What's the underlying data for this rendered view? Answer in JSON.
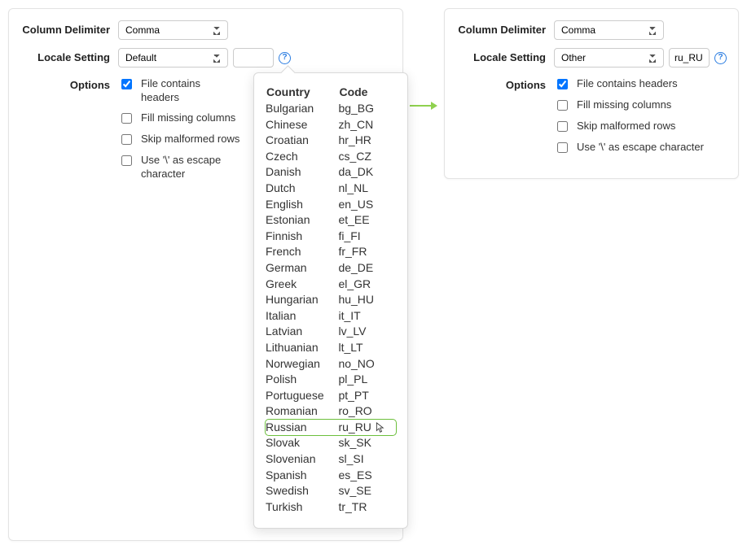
{
  "left": {
    "labels": {
      "column_delimiter": "Column Delimiter",
      "locale_setting": "Locale Setting",
      "options": "Options"
    },
    "column_delimiter_value": "Comma",
    "locale_value": "Default",
    "locale_code_value": "",
    "options": {
      "file_contains_headers": {
        "label": "File contains headers",
        "checked": true
      },
      "fill_missing_columns": {
        "label": "Fill missing columns",
        "checked": false
      },
      "skip_malformed_rows": {
        "label": "Skip malformed rows",
        "checked": false
      },
      "use_escape_char": {
        "label": "Use '\\' as escape character",
        "checked": false
      }
    }
  },
  "right": {
    "labels": {
      "column_delimiter": "Column Delimiter",
      "locale_setting": "Locale Setting",
      "options": "Options"
    },
    "column_delimiter_value": "Comma",
    "locale_value": "Other",
    "locale_code_value": "ru_RU",
    "options": {
      "file_contains_headers": {
        "label": "File contains headers",
        "checked": true
      },
      "fill_missing_columns": {
        "label": "Fill missing columns",
        "checked": false
      },
      "skip_malformed_rows": {
        "label": "Skip malformed rows",
        "checked": false
      },
      "use_escape_char": {
        "label": "Use '\\' as escape character",
        "checked": false
      }
    }
  },
  "popup": {
    "headers": {
      "country": "Country",
      "code": "Code"
    },
    "highlight_code": "ru_RU",
    "rows": [
      {
        "country": "Bulgarian",
        "code": "bg_BG"
      },
      {
        "country": "Chinese",
        "code": "zh_CN"
      },
      {
        "country": "Croatian",
        "code": "hr_HR"
      },
      {
        "country": "Czech",
        "code": "cs_CZ"
      },
      {
        "country": "Danish",
        "code": "da_DK"
      },
      {
        "country": "Dutch",
        "code": "nl_NL"
      },
      {
        "country": "English",
        "code": "en_US"
      },
      {
        "country": "Estonian",
        "code": "et_EE"
      },
      {
        "country": "Finnish",
        "code": "fi_FI"
      },
      {
        "country": "French",
        "code": "fr_FR"
      },
      {
        "country": "German",
        "code": "de_DE"
      },
      {
        "country": "Greek",
        "code": "el_GR"
      },
      {
        "country": "Hungarian",
        "code": "hu_HU"
      },
      {
        "country": "Italian",
        "code": "it_IT"
      },
      {
        "country": "Latvian",
        "code": "lv_LV"
      },
      {
        "country": "Lithuanian",
        "code": "lt_LT"
      },
      {
        "country": "Norwegian",
        "code": "no_NO"
      },
      {
        "country": "Polish",
        "code": "pl_PL"
      },
      {
        "country": "Portuguese",
        "code": "pt_PT"
      },
      {
        "country": "Romanian",
        "code": "ro_RO"
      },
      {
        "country": "Russian",
        "code": "ru_RU"
      },
      {
        "country": "Slovak",
        "code": "sk_SK"
      },
      {
        "country": "Slovenian",
        "code": "sl_SI"
      },
      {
        "country": "Spanish",
        "code": "es_ES"
      },
      {
        "country": "Swedish",
        "code": "sv_SE"
      },
      {
        "country": "Turkish",
        "code": "tr_TR"
      }
    ]
  }
}
